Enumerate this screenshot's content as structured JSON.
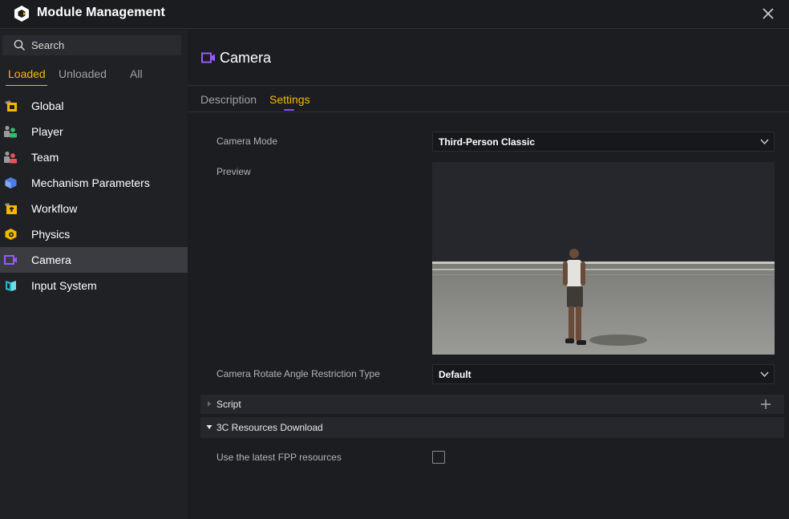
{
  "window": {
    "title": "Module Management",
    "logo_icon": "hexagon-logo-icon",
    "close_icon": "close-icon"
  },
  "sidebar": {
    "search_label": "Search",
    "filter_tabs": [
      {
        "label": "Loaded",
        "active": true
      },
      {
        "label": "Unloaded",
        "active": false
      },
      {
        "label": "All",
        "active": false
      }
    ],
    "modules": [
      {
        "label": "Global",
        "icon": "global-folder-icon",
        "selected": false
      },
      {
        "label": "Player",
        "icon": "player-users-icon",
        "selected": false
      },
      {
        "label": "Team",
        "icon": "team-users-icon",
        "selected": false
      },
      {
        "label": "Mechanism Parameters",
        "icon": "mechanism-hexagon-icon",
        "selected": false
      },
      {
        "label": "Workflow",
        "icon": "workflow-folder-icon",
        "selected": false
      },
      {
        "label": "Physics",
        "icon": "physics-shield-icon",
        "selected": false
      },
      {
        "label": "Camera",
        "icon": "camera-icon",
        "selected": true
      },
      {
        "label": "Input System",
        "icon": "input-system-book-icon",
        "selected": false
      }
    ]
  },
  "detail": {
    "title": "Camera",
    "title_icon": "camera-icon",
    "tabs": [
      {
        "label": "Description",
        "active": false
      },
      {
        "label": "Settings",
        "active": true
      }
    ],
    "fields": {
      "camera_mode_label": "Camera Mode",
      "camera_mode_value": "Third-Person Classic",
      "preview_label": "Preview",
      "rotate_restriction_label": "Camera Rotate Angle Restriction Type",
      "rotate_restriction_value": "Default"
    },
    "sections": {
      "script_label": "Script",
      "script_expanded": false,
      "resources_label": "3C Resources Download",
      "resources_expanded": true
    },
    "checkbox": {
      "label": "Use the latest FPP resources",
      "checked": false
    }
  },
  "colors": {
    "accent": "#f5b800",
    "tab_indicator": "#8a4dff",
    "camera_icon": "#9b59ff",
    "background": "#1c1d21",
    "sidebar": "#202125",
    "selected_item": "#3a3c42"
  }
}
